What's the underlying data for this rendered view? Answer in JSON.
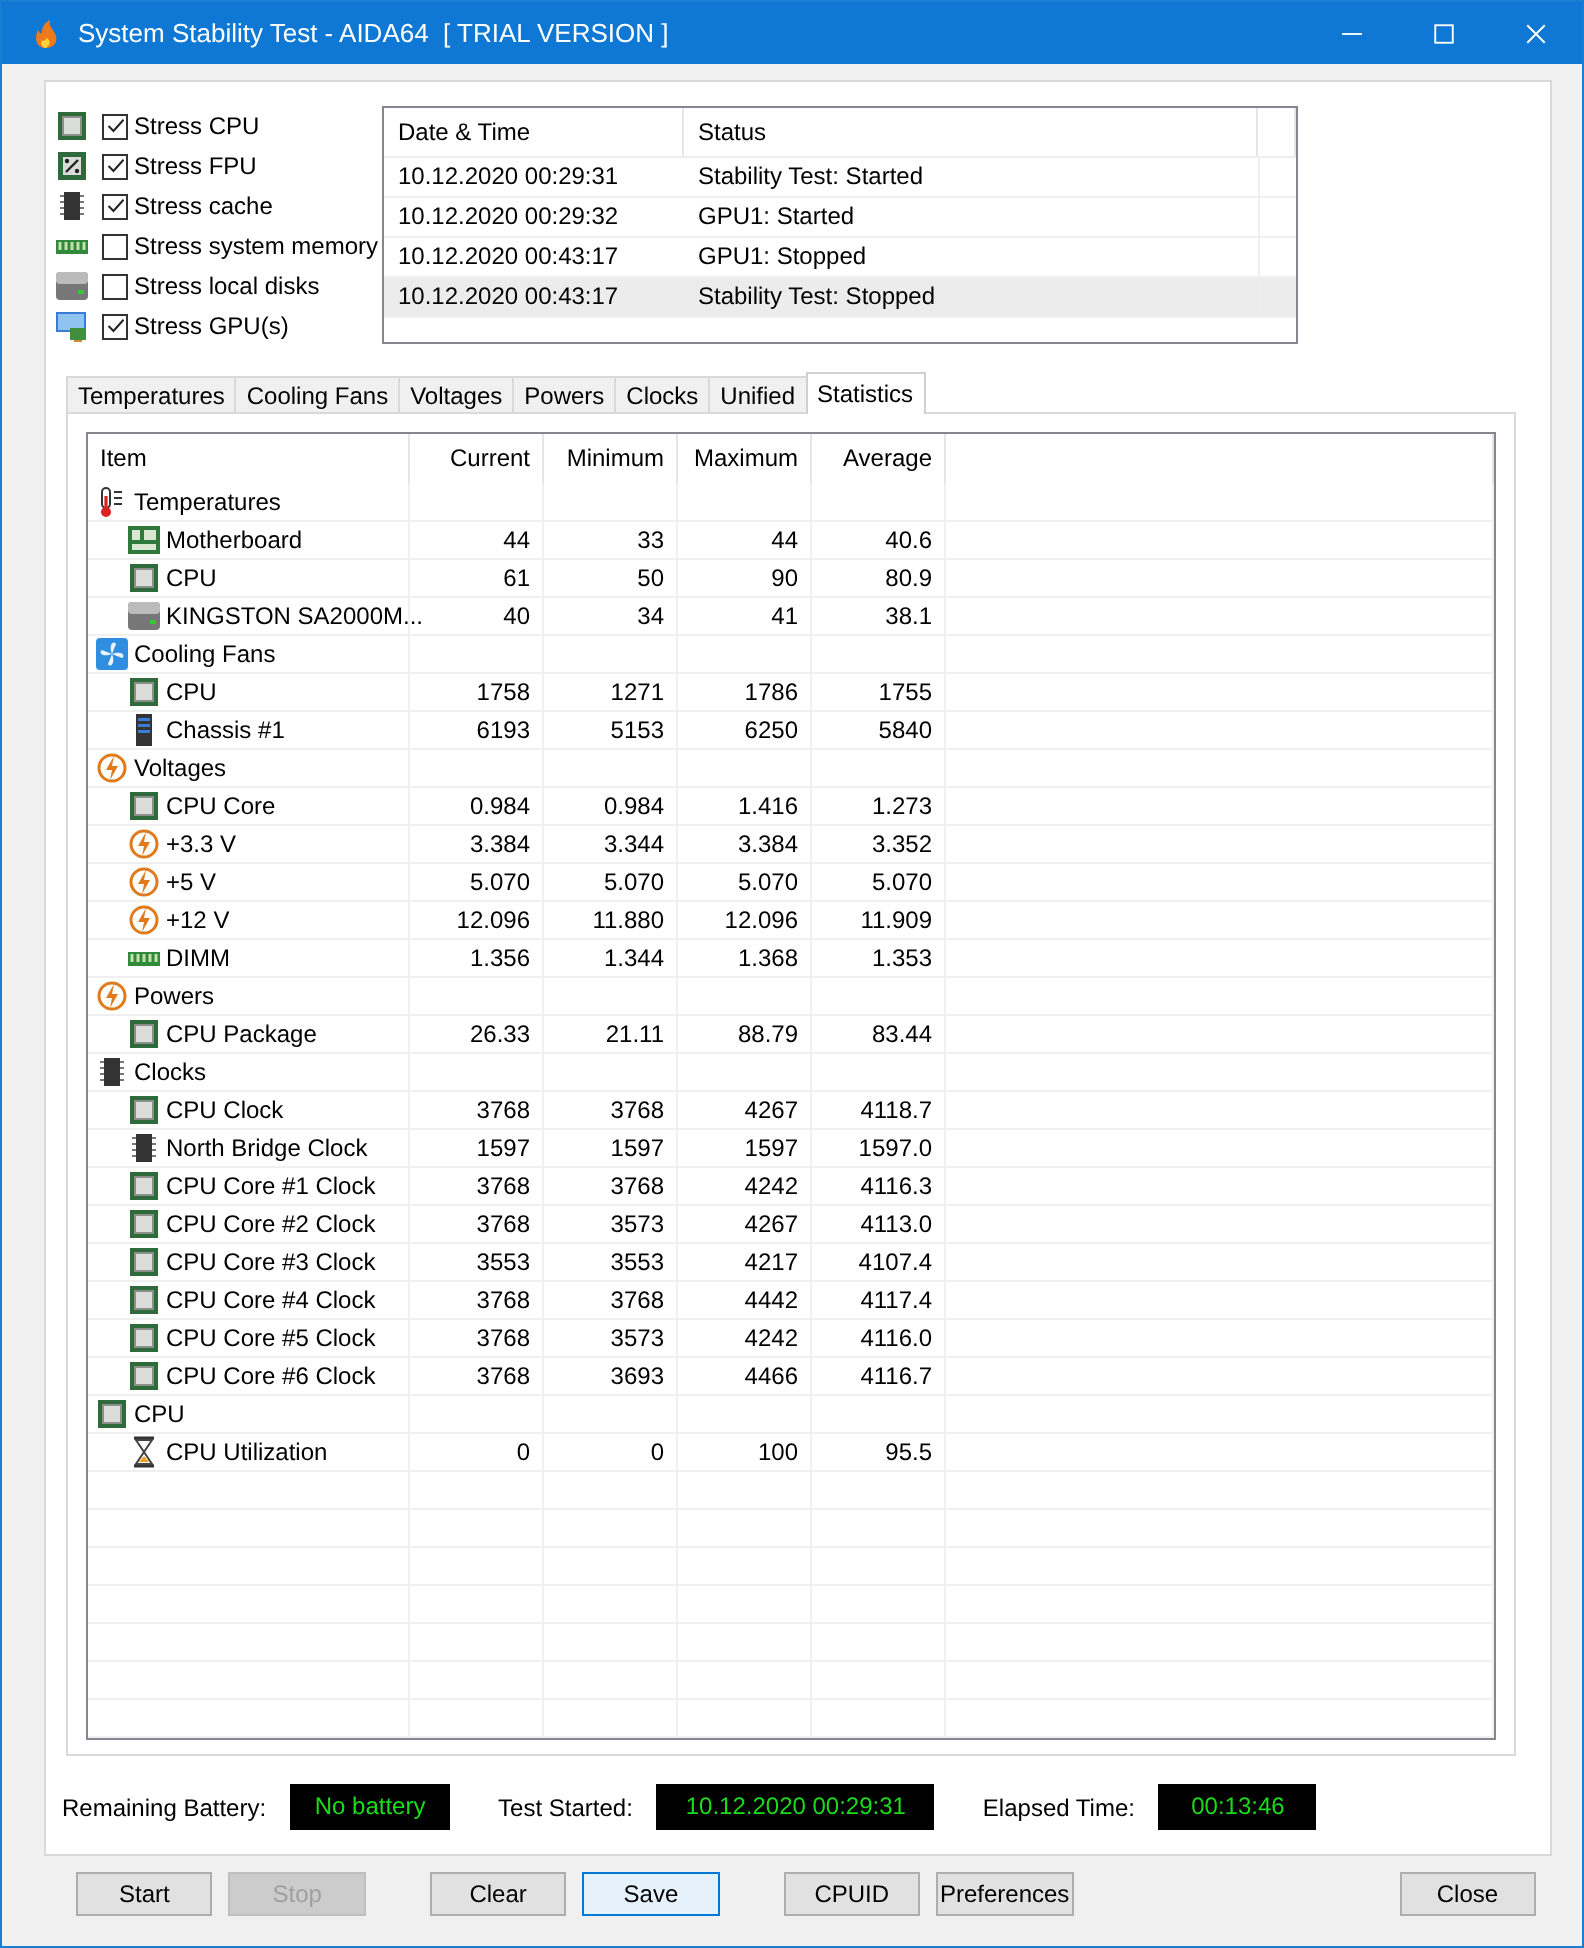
{
  "window": {
    "title": "System Stability Test - AIDA64  [ TRIAL VERSION ]"
  },
  "stress_options": [
    {
      "label": "Stress CPU",
      "kind": "cpu",
      "checked": true
    },
    {
      "label": "Stress FPU",
      "kind": "fpu",
      "checked": true
    },
    {
      "label": "Stress cache",
      "kind": "cache",
      "checked": true
    },
    {
      "label": "Stress system memory",
      "kind": "memory",
      "checked": false
    },
    {
      "label": "Stress local disks",
      "kind": "disk",
      "checked": false
    },
    {
      "label": "Stress GPU(s)",
      "kind": "gpu",
      "checked": true
    }
  ],
  "log": {
    "columns": [
      "Date & Time",
      "Status"
    ],
    "rows": [
      {
        "time": "10.12.2020 00:29:31",
        "status": "Stability Test: Started",
        "selected": false
      },
      {
        "time": "10.12.2020 00:29:32",
        "status": "GPU1: Started",
        "selected": false
      },
      {
        "time": "10.12.2020 00:43:17",
        "status": "GPU1: Stopped",
        "selected": false
      },
      {
        "time": "10.12.2020 00:43:17",
        "status": "Stability Test: Stopped",
        "selected": true
      }
    ]
  },
  "tabs": [
    {
      "label": "Temperatures",
      "selected": false
    },
    {
      "label": "Cooling Fans",
      "selected": false
    },
    {
      "label": "Voltages",
      "selected": false
    },
    {
      "label": "Powers",
      "selected": false
    },
    {
      "label": "Clocks",
      "selected": false
    },
    {
      "label": "Unified",
      "selected": false
    },
    {
      "label": "Statistics",
      "selected": true
    }
  ],
  "statistics": {
    "columns": [
      "Item",
      "Current",
      "Minimum",
      "Maximum",
      "Average"
    ],
    "groups": [
      {
        "label": "Temperatures",
        "kind": "thermo",
        "children": [
          {
            "label": "Motherboard",
            "kind": "board",
            "values": [
              "44",
              "33",
              "44",
              "40.6"
            ]
          },
          {
            "label": "CPU",
            "kind": "cpu",
            "values": [
              "61",
              "50",
              "90",
              "80.9"
            ]
          },
          {
            "label": "KINGSTON SA2000M...",
            "kind": "disk",
            "values": [
              "40",
              "34",
              "41",
              "38.1"
            ]
          }
        ]
      },
      {
        "label": "Cooling Fans",
        "kind": "fan",
        "children": [
          {
            "label": "CPU",
            "kind": "cpu",
            "values": [
              "1758",
              "1271",
              "1786",
              "1755"
            ]
          },
          {
            "label": "Chassis #1",
            "kind": "case",
            "values": [
              "6193",
              "5153",
              "6250",
              "5840"
            ]
          }
        ]
      },
      {
        "label": "Voltages",
        "kind": "volt",
        "children": [
          {
            "label": "CPU Core",
            "kind": "cpu",
            "values": [
              "0.984",
              "0.984",
              "1.416",
              "1.273"
            ]
          },
          {
            "label": "+3.3 V",
            "kind": "volt",
            "values": [
              "3.384",
              "3.344",
              "3.384",
              "3.352"
            ]
          },
          {
            "label": "+5 V",
            "kind": "volt",
            "values": [
              "5.070",
              "5.070",
              "5.070",
              "5.070"
            ]
          },
          {
            "label": "+12 V",
            "kind": "volt",
            "values": [
              "12.096",
              "11.880",
              "12.096",
              "11.909"
            ]
          },
          {
            "label": "DIMM",
            "kind": "memory",
            "values": [
              "1.356",
              "1.344",
              "1.368",
              "1.353"
            ]
          }
        ]
      },
      {
        "label": "Powers",
        "kind": "volt",
        "children": [
          {
            "label": "CPU Package",
            "kind": "cpu",
            "values": [
              "26.33",
              "21.11",
              "88.79",
              "83.44"
            ]
          }
        ]
      },
      {
        "label": "Clocks",
        "kind": "cache",
        "children": [
          {
            "label": "CPU Clock",
            "kind": "cpu",
            "values": [
              "3768",
              "3768",
              "4267",
              "4118.7"
            ]
          },
          {
            "label": "North Bridge Clock",
            "kind": "cache",
            "values": [
              "1597",
              "1597",
              "1597",
              "1597.0"
            ]
          },
          {
            "label": "CPU Core #1 Clock",
            "kind": "cpu",
            "values": [
              "3768",
              "3768",
              "4242",
              "4116.3"
            ]
          },
          {
            "label": "CPU Core #2 Clock",
            "kind": "cpu",
            "values": [
              "3768",
              "3573",
              "4267",
              "4113.0"
            ]
          },
          {
            "label": "CPU Core #3 Clock",
            "kind": "cpu",
            "values": [
              "3553",
              "3553",
              "4217",
              "4107.4"
            ]
          },
          {
            "label": "CPU Core #4 Clock",
            "kind": "cpu",
            "values": [
              "3768",
              "3768",
              "4442",
              "4117.4"
            ]
          },
          {
            "label": "CPU Core #5 Clock",
            "kind": "cpu",
            "values": [
              "3768",
              "3573",
              "4242",
              "4116.0"
            ]
          },
          {
            "label": "CPU Core #6 Clock",
            "kind": "cpu",
            "values": [
              "3768",
              "3693",
              "4466",
              "4116.7"
            ]
          }
        ]
      },
      {
        "label": "CPU",
        "kind": "cpu",
        "children": [
          {
            "label": "CPU Utilization",
            "kind": "hourglass",
            "values": [
              "0",
              "0",
              "100",
              "95.5"
            ]
          }
        ]
      }
    ]
  },
  "info": [
    {
      "label": "Remaining Battery:",
      "value": "No battery"
    },
    {
      "label": "Test Started:",
      "value": "10.12.2020 00:29:31"
    },
    {
      "label": "Elapsed Time:",
      "value": "00:13:46"
    }
  ],
  "buttons": [
    {
      "label": "Start",
      "disabled": false,
      "focused": false
    },
    {
      "label": "Stop",
      "disabled": true,
      "focused": false
    },
    {
      "label": "Clear",
      "disabled": false,
      "focused": false
    },
    {
      "label": "Save",
      "disabled": false,
      "focused": true
    },
    {
      "label": "CPUID",
      "disabled": false,
      "focused": false
    },
    {
      "label": "Preferences",
      "disabled": false,
      "focused": false
    },
    {
      "label": "Close",
      "disabled": false,
      "focused": false
    }
  ]
}
